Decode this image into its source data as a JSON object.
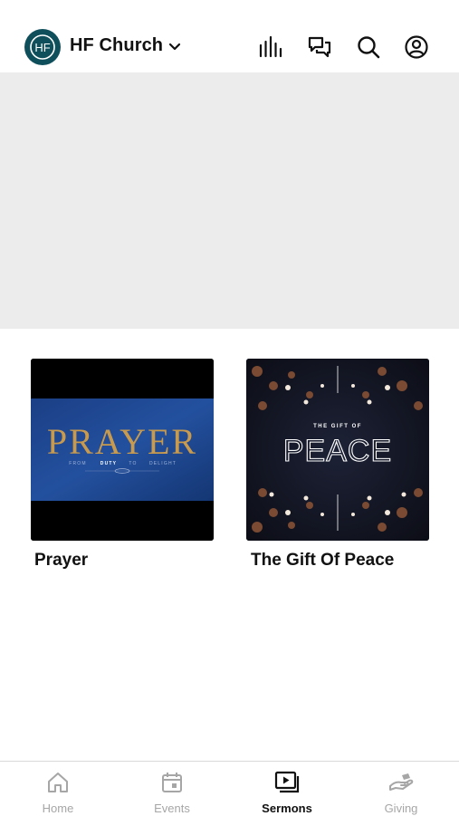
{
  "header": {
    "logo_text": "HF",
    "church_name": "HF Church",
    "icons": [
      "chevron-down-icon",
      "audio-bars-icon",
      "chat-icon",
      "search-icon",
      "account-icon"
    ]
  },
  "sermons": [
    {
      "title": "Prayer",
      "artwork": {
        "word": "PRAYER",
        "subtitle_parts": [
          "FROM",
          "DUTY",
          "TO",
          "DELIGHT"
        ]
      }
    },
    {
      "title": "The Gift Of Peace",
      "artwork": {
        "kicker": "THE GIFT OF",
        "word": "PEACE"
      }
    }
  ],
  "tabs": [
    {
      "label": "Home",
      "icon": "home-icon",
      "active": false
    },
    {
      "label": "Events",
      "icon": "calendar-icon",
      "active": false
    },
    {
      "label": "Sermons",
      "icon": "video-library-icon",
      "active": true
    },
    {
      "label": "Giving",
      "icon": "hand-giving-icon",
      "active": false
    }
  ],
  "colors": {
    "logo_bg": "#0f4f5c",
    "hero_bg": "#ececed",
    "active_tab": "#111111",
    "inactive_tab": "#a6a6a6"
  }
}
